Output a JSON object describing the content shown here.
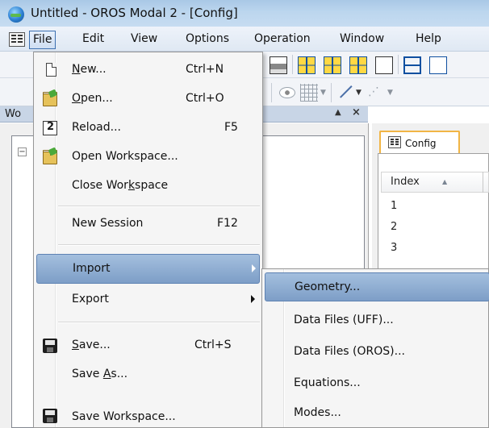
{
  "window": {
    "title": "Untitled - OROS Modal 2 - [Config]"
  },
  "menubar": {
    "items": [
      {
        "label": "File",
        "active": true
      },
      {
        "label": "Edit"
      },
      {
        "label": "View"
      },
      {
        "label": "Options"
      },
      {
        "label": "Operation"
      },
      {
        "label": "Window"
      },
      {
        "label": "Help"
      }
    ]
  },
  "workspace": {
    "title": "Wo"
  },
  "config": {
    "tab_label": "Config",
    "column_header": "Index",
    "rows": [
      "1",
      "2",
      "3"
    ]
  },
  "file_menu": {
    "items": [
      {
        "icon": "new-document-icon",
        "pre": "",
        "accel": "N",
        "post": "ew...",
        "shortcut": "Ctrl+N"
      },
      {
        "icon": "open-folder-icon",
        "pre": "",
        "accel": "O",
        "post": "pen...",
        "shortcut": "Ctrl+O"
      },
      {
        "icon": "reload-icon",
        "label": "Reload...",
        "shortcut": "F5"
      },
      {
        "icon": "open-workspace-icon",
        "label": "Open Workspace..."
      },
      {
        "pre": "Close Wor",
        "accel": "k",
        "post": "space"
      },
      {
        "label": "New Session",
        "shortcut": "F12"
      },
      {
        "label": "Import",
        "submenu": true,
        "highlighted": true
      },
      {
        "label": "Export",
        "submenu": true
      },
      {
        "icon": "save-disk-icon",
        "pre": "",
        "accel": "S",
        "post": "ave...",
        "shortcut": "Ctrl+S"
      },
      {
        "pre": "Save ",
        "accel": "A",
        "post": "s..."
      },
      {
        "icon": "save-workspace-icon",
        "label": "Save Workspace..."
      }
    ]
  },
  "import_submenu": {
    "items": [
      {
        "label": "Geometry...",
        "highlighted": true
      },
      {
        "label": "Data Files (UFF)..."
      },
      {
        "label": "Data Files (OROS)..."
      },
      {
        "label": "Equations..."
      },
      {
        "label": "Modes..."
      }
    ]
  }
}
